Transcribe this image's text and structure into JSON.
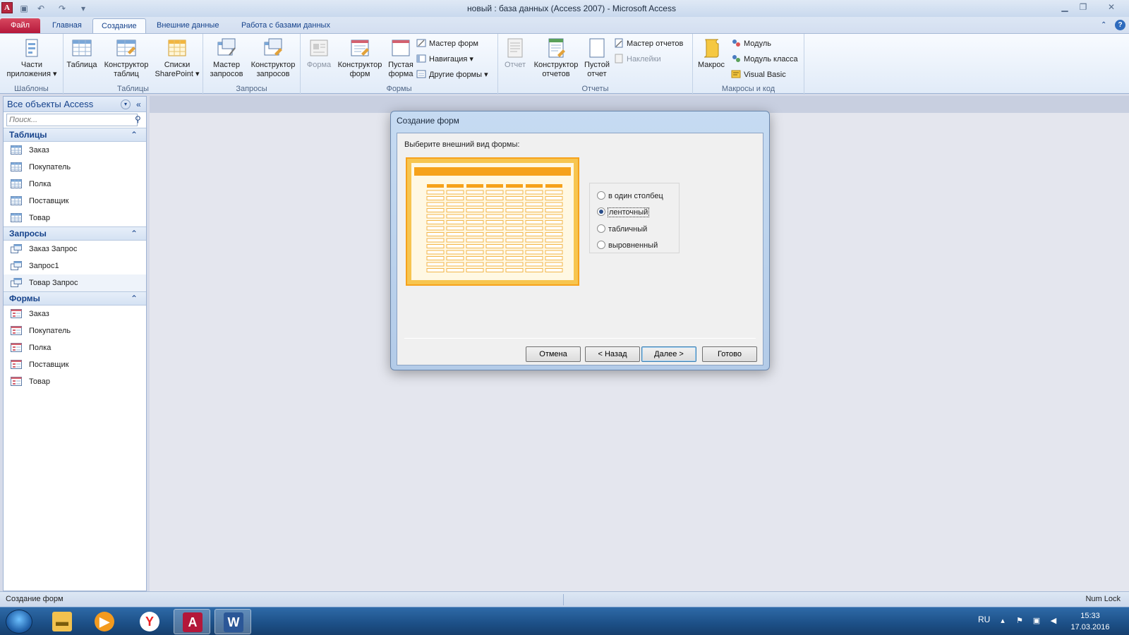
{
  "window": {
    "title": "новый : база данных (Access 2007) - Microsoft Access",
    "app_icon": "A"
  },
  "tabs": {
    "file": "Файл",
    "home": "Главная",
    "create": "Создание",
    "external": "Внешние данные",
    "database": "Работа с базами данных"
  },
  "ribbon": {
    "templates": {
      "label": "Шаблоны",
      "app_parts_1": "Части",
      "app_parts_2": "приложения ▾"
    },
    "tables": {
      "label": "Таблицы",
      "table": "Таблица",
      "table_design_1": "Конструктор",
      "table_design_2": "таблиц",
      "sharepoint_1": "Списки",
      "sharepoint_2": "SharePoint ▾"
    },
    "queries": {
      "label": "Запросы",
      "wizard_1": "Мастер",
      "wizard_2": "запросов",
      "design_1": "Конструктор",
      "design_2": "запросов"
    },
    "forms": {
      "label": "Формы",
      "form": "Форма",
      "design_1": "Конструктор",
      "design_2": "форм",
      "blank_1": "Пустая",
      "blank_2": "форма",
      "wizard": "Мастер форм",
      "navigation": "Навигация ▾",
      "other": "Другие формы ▾"
    },
    "reports": {
      "label": "Отчеты",
      "report": "Отчет",
      "design_1": "Конструктор",
      "design_2": "отчетов",
      "blank_1": "Пустой",
      "blank_2": "отчет",
      "wizard": "Мастер отчетов",
      "labels": "Наклейки"
    },
    "macros": {
      "label": "Макросы и код",
      "macro": "Макрос",
      "module": "Модуль",
      "class_module": "Модуль класса",
      "vb": "Visual Basic"
    }
  },
  "nav": {
    "header": "Все объекты Access",
    "search_placeholder": "Поиск...",
    "tables_header": "Таблицы",
    "tables": [
      "Заказ",
      "Покупатель",
      "Полка",
      "Поставщик",
      "Товар"
    ],
    "queries_header": "Запросы",
    "queries": [
      "Заказ Запрос",
      "Запрос1",
      "Товар Запрос"
    ],
    "forms_header": "Формы",
    "forms": [
      "Заказ",
      "Покупатель",
      "Полка",
      "Поставщик",
      "Товар"
    ]
  },
  "dialog": {
    "title": "Создание форм",
    "prompt": "Выберите внешний вид формы:",
    "options": [
      "в один столбец",
      "ленточный",
      "табличный",
      "выровненный"
    ],
    "selected_option": "ленточный",
    "buttons": {
      "cancel": "Отмена",
      "back": "< Назад",
      "next": "Далее >",
      "finish": "Готово"
    }
  },
  "status": {
    "left": "Создание форм",
    "right": "Num Lock"
  },
  "taskbar": {
    "lang": "RU",
    "time": "15:33",
    "date": "17.03.2016"
  },
  "colors": {
    "accent_file_tab": "#b3173a",
    "ribbon_text": "#15428b",
    "preview_orange": "#f6a21b"
  }
}
